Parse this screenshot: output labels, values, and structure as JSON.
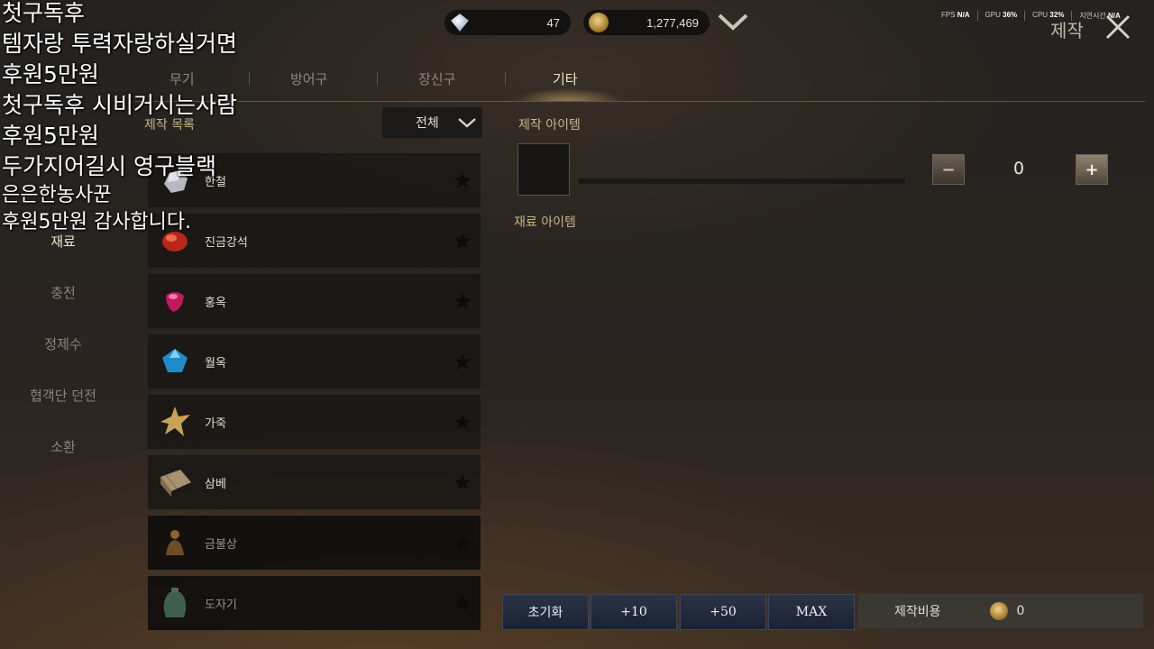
{
  "topbar": {
    "gems": "47",
    "gold": "1,277,469",
    "stats": {
      "fps_label": "FPS",
      "fps": "N/A",
      "gpu_label": "GPU",
      "gpu": "36%",
      "cpu_label": "CPU",
      "cpu": "32%",
      "latency_label": "지연시간",
      "latency": "N/A"
    },
    "title": "제작"
  },
  "tabs": [
    "무기",
    "방어구",
    "장신구",
    "기타"
  ],
  "active_tab": "기타",
  "left_nav": [
    "재료",
    "충전",
    "정제수",
    "협객단 던전",
    "소환"
  ],
  "active_nav": "재료",
  "list": {
    "title": "제작 목록",
    "filter": "전체",
    "items": [
      {
        "name": "한철",
        "icon": "ore-icon"
      },
      {
        "name": "진금강석",
        "icon": "red-gem-icon"
      },
      {
        "name": "홍옥",
        "icon": "ruby-icon"
      },
      {
        "name": "월옥",
        "icon": "sapphire-icon"
      },
      {
        "name": "가죽",
        "icon": "leather-icon"
      },
      {
        "name": "삼베",
        "icon": "hemp-cloth-icon"
      },
      {
        "name": "금불상",
        "icon": "gold-buddha-icon"
      },
      {
        "name": "도자기",
        "icon": "porcelain-vase-icon"
      }
    ]
  },
  "craft": {
    "item_title": "제작 아이템",
    "material_title": "재료 아이템",
    "quantity": "0",
    "minus": "−",
    "plus": "+"
  },
  "bottom": {
    "reset": "초기화",
    "plus10": "+10",
    "plus50": "+50",
    "max": "MAX",
    "cost_label": "제작비용",
    "cost_value": "0"
  },
  "overlay": [
    "첫구독후",
    "템자랑 투력자랑하실거면",
    "후원5만원",
    "첫구독후 시비거시는사람",
    "후원5만원",
    "두가지어길시 영구블랙",
    "은은한농사꾼",
    "후원5만원 감사합니다."
  ],
  "colors": {
    "accent_gold": "#c9b58a",
    "button_blue": "#2a3346",
    "active_text": "#f1e6c8"
  }
}
